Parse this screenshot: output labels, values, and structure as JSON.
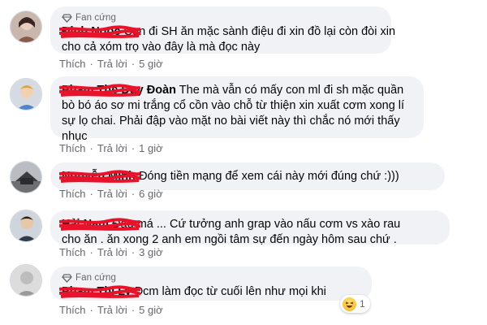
{
  "badge_label": "Fan cứng",
  "actions": {
    "like": "Thích",
    "reply": "Trả lời",
    "sep": "·"
  },
  "comments": [
    {
      "fan": true,
      "name": "Đinh Ngọc",
      "text_lines": [
        "Con đi SH ăn mặc sành điệu đi xin đồ lại còn đòi xin",
        "cho cả xóm trọ vào đây là mà đọc này"
      ],
      "time": "5 giờ"
    },
    {
      "fan": false,
      "name": "Phạm Thế Duy Đoàn",
      "text_lines": [
        "The mà vẫn có mấy con ml đi sh mặc quần",
        "bò bó áo sơ mi trắng cổ cồn vào chỗ từ thiện xin xuất cơm xong lí",
        "sự lọ chai. Phải đập vào mặt no bài viết này thì chắc nó mới thấy",
        "nhục"
      ],
      "time": "1 giờ"
    },
    {
      "fan": false,
      "name": "Nguyễn Minh",
      "text_lines": [
        "Đóng tiền mạng để xem cái này mới đúng chứ :)))"
      ],
      "time": "6 giờ"
    },
    {
      "fan": false,
      "name": "Hải Nam",
      "text_lines": [
        "Đậu má ... Cứ tưởng anh grap vào nấu cơm vs xào rau",
        "cho ăn . ăn xong 2 anh em ngồi tâm sự đến ngày hôm sau chứ ."
      ],
      "time": "3 giờ"
    },
    {
      "fan": true,
      "name": "Phạm Thị Ly",
      "text_lines": [
        "Dcm làm đọc từ cuối lên như mọi khi"
      ],
      "time": "5 giờ",
      "reaction": {
        "icon": "haha-emoji-icon",
        "count": "1"
      }
    }
  ],
  "colors": {
    "bubble": "#f0f2f5",
    "scribble": "#e8132b",
    "meta": "#65676b"
  }
}
